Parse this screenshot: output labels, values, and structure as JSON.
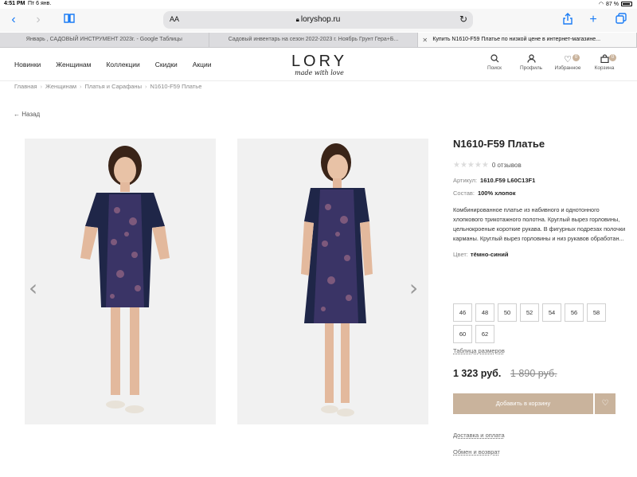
{
  "status_bar": {
    "time": "4:51 PM",
    "date": "Пт 6 янв.",
    "battery": "87 %"
  },
  "browser": {
    "url": "loryshop.ru",
    "aa_label": "AA",
    "tabs": [
      {
        "label": "Январь , САДОВЫЙ ИНСТРУМЕНТ 2023г. - Google Таблицы",
        "active": false
      },
      {
        "label": "Садовый инвентарь на сезон 2022-2023 г. Ноябрь Грунт Гера+Б...",
        "active": false
      },
      {
        "label": "Купить N1610-F59 Платье по низкой цене в интернет-магазине...",
        "active": true
      }
    ]
  },
  "header": {
    "nav": [
      "Новинки",
      "Женщинам",
      "Коллекции",
      "Скидки",
      "Акции"
    ],
    "logo": {
      "brand": "LORY",
      "tagline": "made with love"
    },
    "icons": [
      {
        "name": "search-icon",
        "label": "Поиск",
        "count": ""
      },
      {
        "name": "profile-icon",
        "label": "Профиль",
        "count": ""
      },
      {
        "name": "heart-icon",
        "label": "Избранное",
        "count": "0"
      },
      {
        "name": "bag-icon",
        "label": "Корзина",
        "count": "0"
      }
    ]
  },
  "breadcrumb": [
    "Главная",
    "Женщинам",
    "Платья и Сарафаны",
    "N1610-F59 Платье"
  ],
  "back_label": "Назад",
  "product": {
    "title": "N1610-F59 Платье",
    "reviews": "0 отзывов",
    "sku_label": "Артикул:",
    "sku": "1610.F59 L60C13F1",
    "composition_label": "Состав:",
    "composition": "100% хлопок",
    "description": "Комбинированное платье из набивного и однотонного хлопкового трикотажного полотна. Круглый вырез горловины, цельнокроеные короткие рукава. В фигурных подрезах полочки карманы. Круглый вырез горловины и низ рукавов обработан...",
    "color_label": "Цвет:",
    "color": "тёмно-синий",
    "sizes": [
      "46",
      "48",
      "50",
      "52",
      "54",
      "56",
      "58",
      "60",
      "62"
    ],
    "size_table": "Таблица размеров",
    "price": "1 323 руб.",
    "old_price": "1 890 руб.",
    "add_to_cart": "Добавить в корзину",
    "delivery_link": "Доставка и оплата",
    "return_link": "Обмен и возврат"
  },
  "colors": {
    "accent": "#c9b39c",
    "ios_blue": "#1a7cf5",
    "dress": "#1f2648"
  }
}
